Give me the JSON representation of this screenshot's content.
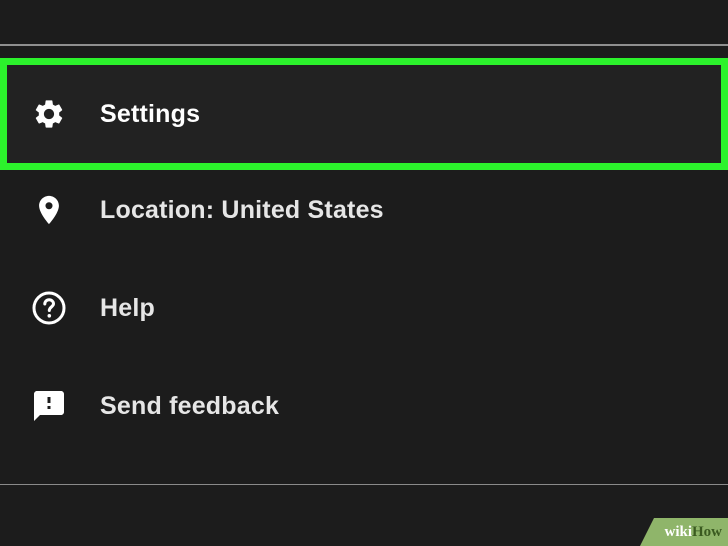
{
  "menu": {
    "items": [
      {
        "label": "Settings",
        "icon": "gear-icon",
        "highlighted": true
      },
      {
        "label": "Location: United States",
        "icon": "location-pin-icon",
        "highlighted": false
      },
      {
        "label": "Help",
        "icon": "help-circle-icon",
        "highlighted": false
      },
      {
        "label": "Send feedback",
        "icon": "feedback-icon",
        "highlighted": false
      }
    ]
  },
  "colors": {
    "background": "#1c1c1c",
    "highlight_border": "#2cf22c",
    "text": "#e6e6e6",
    "icon": "#ffffff"
  },
  "watermark": {
    "part1": "wiki",
    "part2": "How"
  }
}
